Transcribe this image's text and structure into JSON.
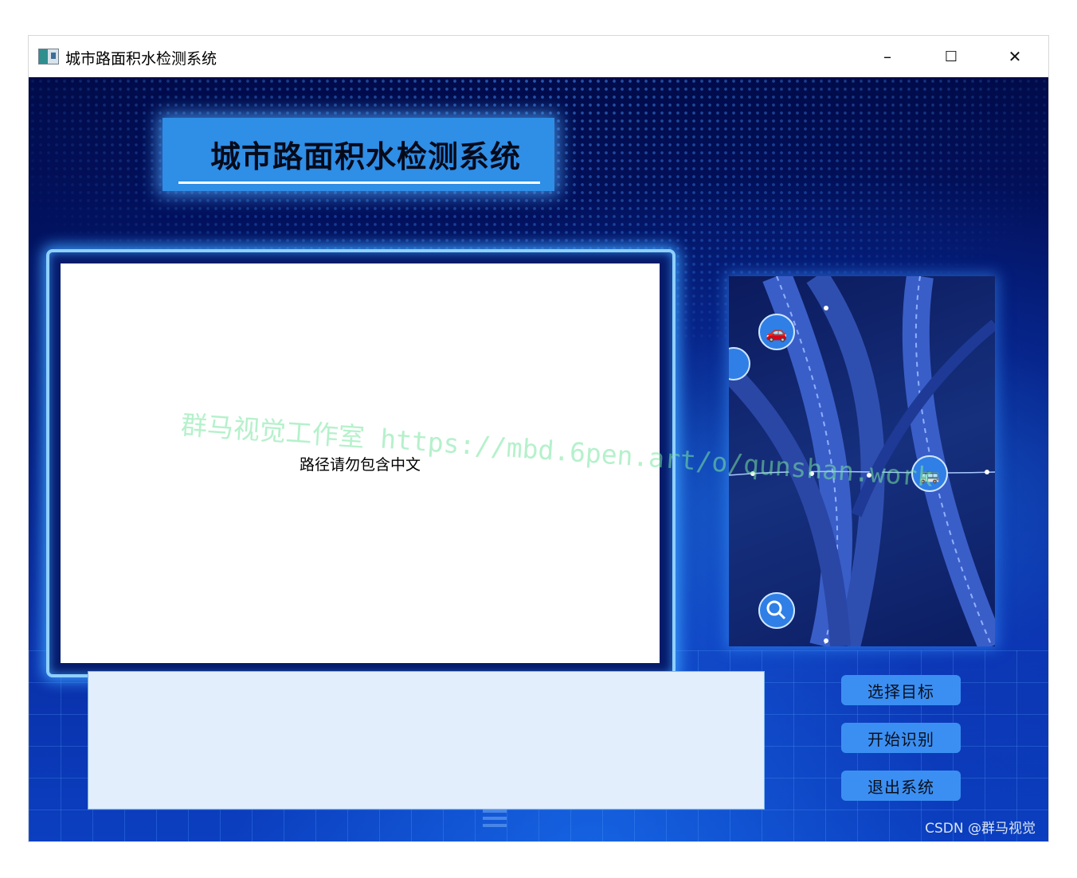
{
  "window": {
    "title": "城市路面积水检测系统",
    "controls": {
      "minimize": "–",
      "maximize": "☐",
      "close": "✕"
    }
  },
  "header": {
    "title": "城市路面积水检测系统"
  },
  "image_display": {
    "hint": "路径请勿包含中文"
  },
  "buttons": {
    "select_target": "选择目标",
    "start_recognition": "开始识别",
    "exit_system": "退出系统"
  },
  "watermark": "群马视觉工作室 https://mbd.6pen.art/o/qunshan.work",
  "footer": {
    "credit": "CSDN @群马视觉"
  },
  "colors": {
    "background_top": "#010b4a",
    "background_bottom": "#0b3fc0",
    "header_bg": "#2f8ee6",
    "button_bg": "#3b8ff2",
    "log_bg": "#e3eefc",
    "frame_glow": "#8fd0ff"
  },
  "icons": [
    "car-icon",
    "truck-icon",
    "bus-icon",
    "search-icon"
  ]
}
